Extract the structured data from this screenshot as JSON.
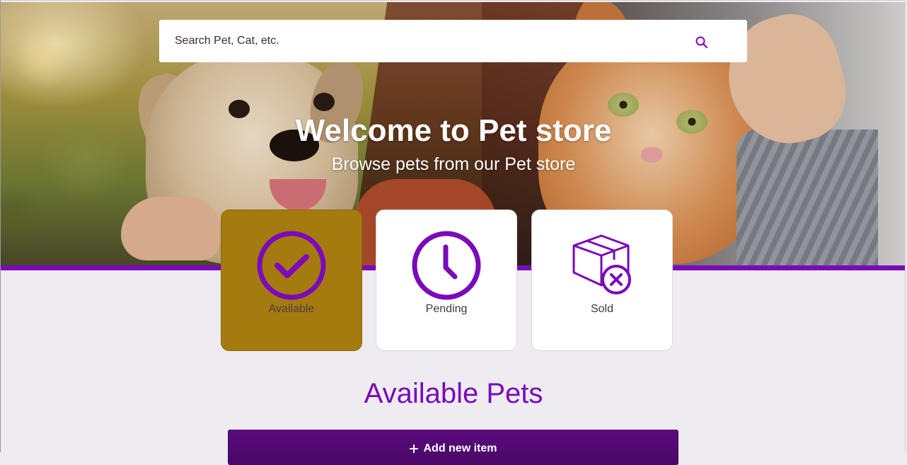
{
  "search": {
    "placeholder": "Search Pet, Cat, etc.",
    "icon": "search-icon"
  },
  "hero": {
    "title": "Welcome to Pet store",
    "subtitle": "Browse pets from our Pet store"
  },
  "status_cards": [
    {
      "label": "Available",
      "icon": "check-circle-icon",
      "active": true
    },
    {
      "label": "Pending",
      "icon": "clock-icon",
      "active": false
    },
    {
      "label": "Sold",
      "icon": "box-cancel-icon",
      "active": false
    }
  ],
  "section": {
    "title": "Available Pets"
  },
  "actions": {
    "add_label": "Add new item",
    "add_icon": "plus-icon"
  },
  "colors": {
    "accent": "#7a0aba",
    "active_card": "#a57a0f",
    "background": "#efecf1",
    "button": "#5b0a7a"
  }
}
